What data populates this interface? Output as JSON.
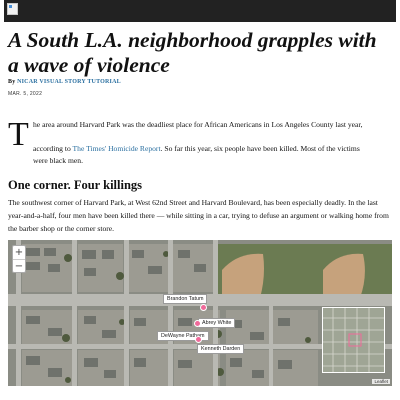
{
  "header": {
    "logo_alt": "image"
  },
  "article": {
    "headline": "A South L.A. neighborhood grapples with a wave of violence",
    "byline_prefix": "By ",
    "byline_author": "NICAR VISUAL STORY TUTORIAL",
    "date": "MAR. 5, 2022",
    "dropcap": "T",
    "lede_line1": "he area around Harvard Park was the deadliest place for African Americans in Los Angeles County last year,",
    "lede_prefix": "according to ",
    "lede_link": "The Times' Homicide Report",
    "lede_suffix": ". So far this year, six people have been killed. Most of the victims were black men.",
    "section_heading": "One corner. Four killings",
    "para2": "The southwest corner of Harvard Park, at West 62nd Street and Harvard Boulevard, has been especially deadly. In the last year-and-a-half, four men have been killed there — while sitting in a car, trying to defuse an argument or walking home from the barber shop or the corner store."
  },
  "map": {
    "zoom_in": "+",
    "zoom_out": "−",
    "labels": [
      "Brandon Tatum",
      "Abrey White",
      "DeWayne Patham",
      "Kenneth Darden"
    ],
    "credit": "Leaflet",
    "pin_color": "#f06a9a"
  }
}
